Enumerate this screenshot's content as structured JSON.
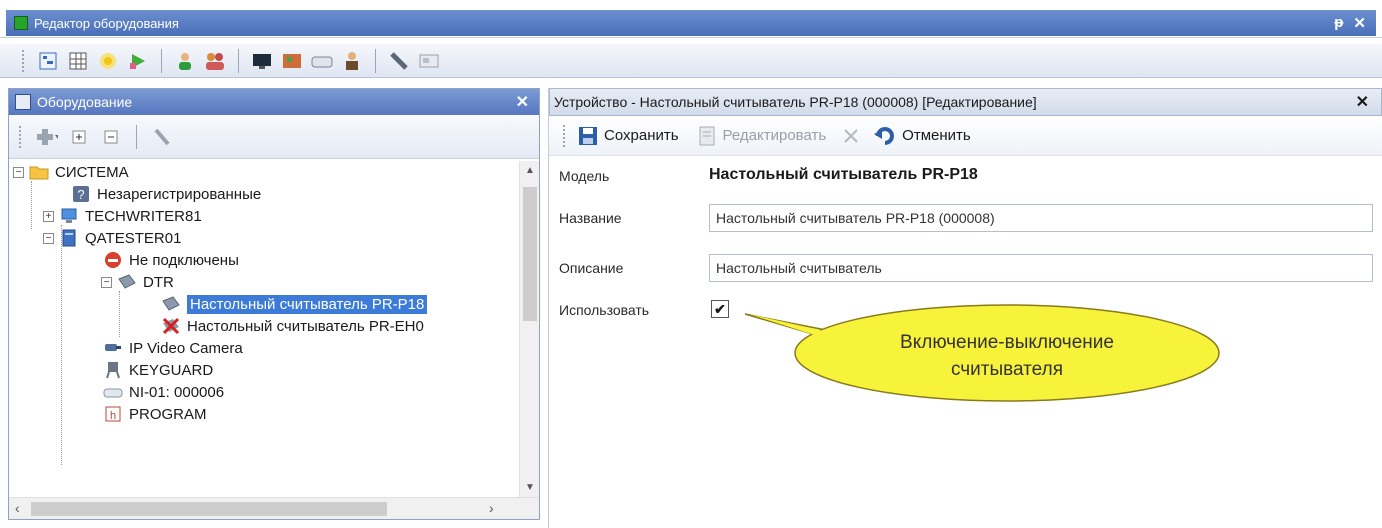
{
  "window": {
    "title": "Редактор оборудования",
    "controls": [
      "pin-icon",
      "close-icon"
    ]
  },
  "main_toolbar": {
    "icons": [
      "tree-view-icon",
      "grid-view-icon",
      "star-icon",
      "play-icon",
      "user-icon",
      "users-icon",
      "monitor-icon",
      "map-icon",
      "device-icon",
      "person-icon",
      "wrench-icon",
      "card-icon"
    ]
  },
  "left_panel": {
    "title": "Оборудование",
    "toolbar_icons": [
      "add-icon",
      "expand-all-icon",
      "collapse-all-icon",
      "wrench-icon"
    ],
    "tree": [
      {
        "label": "СИСТЕМА",
        "icon": "folder-icon"
      },
      {
        "label": "Незарегистрированные",
        "icon": "question-icon"
      },
      {
        "label": "TECHWRITER81",
        "icon": "computer-icon"
      },
      {
        "label": "QATESTER01",
        "icon": "server-icon"
      },
      {
        "label": "Не подключены",
        "icon": "stop-icon"
      },
      {
        "label": "DTR",
        "icon": "reader-icon"
      },
      {
        "label": "Настольный считыватель PR-P18",
        "icon": "reader-icon",
        "selected": true
      },
      {
        "label": "Настольный считыватель PR-EH0",
        "icon": "reader-error-icon"
      },
      {
        "label": "IP Video Camera",
        "icon": "camera-icon"
      },
      {
        "label": "KEYGUARD",
        "icon": "keyguard-icon"
      },
      {
        "label": "NI-01: 000006",
        "icon": "network-icon"
      },
      {
        "label": "PROGRAM",
        "icon": "program-icon"
      }
    ]
  },
  "right_panel": {
    "title": "Устройство - Настольный считыватель PR-P18 (000008) [Редактирование]",
    "toolbar": {
      "save": "Сохранить",
      "edit": "Редактировать",
      "cancel": "Отменить"
    },
    "form": {
      "model_label": "Модель",
      "model_value": "Настольный считыватель PR-P18",
      "name_label": "Название",
      "name_value": "Настольный считыватель PR-P18 (000008)",
      "description_label": "Описание",
      "description_value": "Настольный считыватель",
      "use_label": "Использовать",
      "use_checked": true
    },
    "callout": {
      "line1": "Включение-выключение",
      "line2": "считывателя"
    }
  },
  "colors": {
    "title_bar": "#5677bf",
    "selection": "#3d7bd8",
    "callout_fill": "#f7f23a"
  }
}
